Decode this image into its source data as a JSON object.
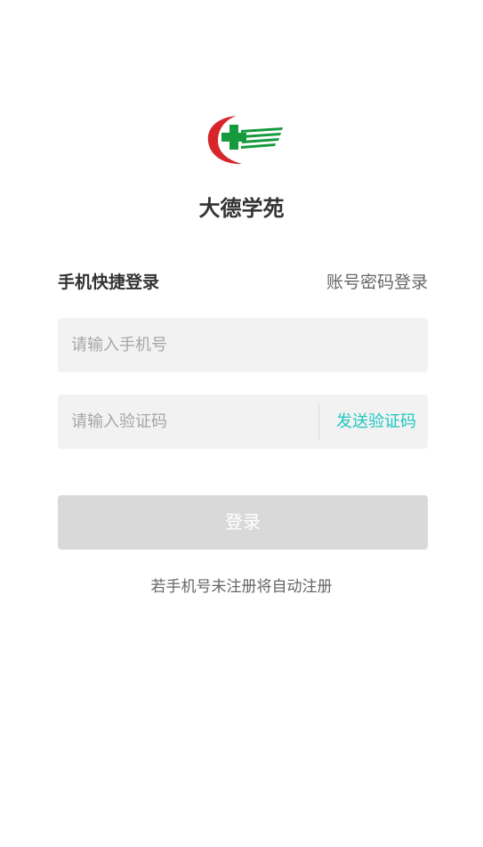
{
  "app": {
    "name": "大德学苑"
  },
  "logo": {
    "icon": "cross-crescent-logo",
    "colors": {
      "red": "#d7262b",
      "green": "#159a3d"
    }
  },
  "tabs": {
    "active": "手机快捷登录",
    "inactive": "账号密码登录"
  },
  "phone": {
    "placeholder": "请输入手机号",
    "value": ""
  },
  "code": {
    "placeholder": "请输入验证码",
    "value": "",
    "send_label": "发送验证码"
  },
  "login": {
    "label": "登录",
    "state": "disabled"
  },
  "hint": "若手机号未注册将自动注册",
  "colors": {
    "accent": "#1ec7c1",
    "button_disabled": "#d9d9d9",
    "field_bg": "#f2f2f2"
  }
}
